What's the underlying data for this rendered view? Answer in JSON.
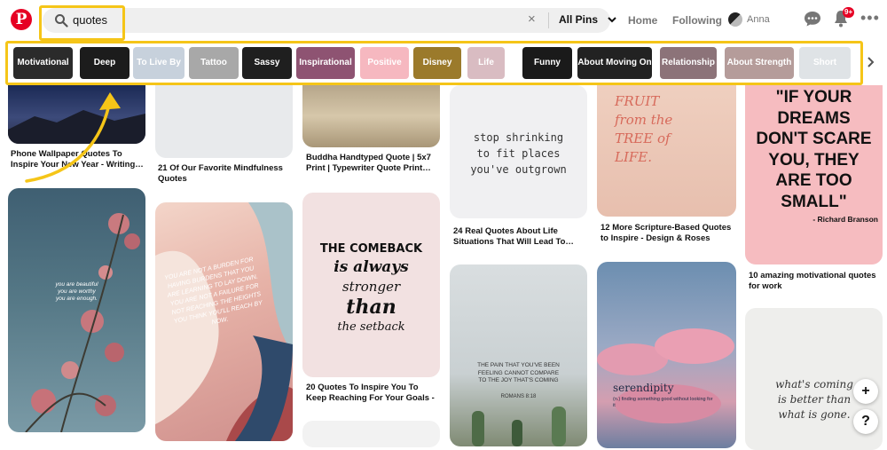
{
  "header": {
    "logo": "P",
    "search_value": "quotes",
    "clear_symbol": "×",
    "search_scope": "All Pins",
    "nav": {
      "home": "Home",
      "following": "Following",
      "user": "Anna"
    },
    "notification_count": "9+",
    "more_symbol": "•••"
  },
  "filters": [
    {
      "label": "Motivational",
      "color": "#2b2b2b"
    },
    {
      "label": "Deep",
      "color": "#1c1c1c"
    },
    {
      "label": "To Live By",
      "color": "#c7d1dc"
    },
    {
      "label": "Tattoo",
      "color": "#a8a8a8"
    },
    {
      "label": "Sassy",
      "color": "#1f1f1f"
    },
    {
      "label": "Inspirational",
      "color": "#8e5372"
    },
    {
      "label": "Positive",
      "color": "#f6b8c0"
    },
    {
      "label": "Disney",
      "color": "#9b7a2b"
    },
    {
      "label": "Life",
      "color": "#d9bcc2"
    },
    {
      "label": "Funny",
      "color": "#1a1a1a"
    },
    {
      "label": "About Moving On",
      "color": "#222222"
    },
    {
      "label": "Relationship",
      "color": "#8c7379"
    },
    {
      "label": "About Strength",
      "color": "#b59c9a"
    },
    {
      "label": "Short",
      "color": "#dfe3e6"
    }
  ],
  "pins": {
    "p1": {
      "caption": "Phone Wallpaper Quotes To Inspire Your New Year - Writing…"
    },
    "p2": {
      "caption": "21 Of Our Favorite Mindfulness Quotes"
    },
    "p3": {
      "caption": "Buddha Handtyped Quote | 5x7 Print | Typewriter Quote Print…"
    },
    "p4": {
      "text": "stop shrinking\nto fit places\nyou've outgrown",
      "caption": "24 Real Quotes About Life Situations That Will Lead To…"
    },
    "p5": {
      "text": "FRUIT\nfrom the\nTREE of\nLIFE.",
      "caption": "12 More Scripture-Based Quotes to Inspire - Design & Roses"
    },
    "p6": {
      "text": "\"IF YOUR DREAMS DON'T SCARE YOU, THEY ARE TOO SMALL\"",
      "author": "- Richard Branson",
      "caption": "10 amazing motivational quotes for work"
    },
    "p7": {
      "text": "you are beautiful\nyou are worthy\nyou are enough."
    },
    "p8": {
      "text": "YOU ARE NOT A BURDEN FOR HAVING BURDENS THAT YOU ARE LEARNING TO LAY DOWN. YOU ARE NOT A FAILURE FOR NOT REACHING THE HEIGHTS YOU THINK YOU'LL REACH BY NOW."
    },
    "p9": {
      "text_1": "THE COMEBACK",
      "text_2": "is always",
      "text_3": "stronger",
      "text_4": "than",
      "text_5": "the setback",
      "caption": "20 Quotes To Inspire You To Keep Reaching For Your Goals -"
    },
    "p10": {
      "text": "THE PAIN THAT YOU'VE BEEN FEELING CANNOT COMPARE TO THE JOY THAT'S COMING",
      "ref": "ROMANS 8:18"
    },
    "p11": {
      "title": "serendipity",
      "sub": "(n.) finding something good without looking for it"
    },
    "p12": {
      "text": "what's coming is better than what is gone."
    }
  },
  "fab": {
    "plus": "+",
    "help": "?"
  },
  "colors": {
    "highlight": "#f5c518",
    "brand": "#e60023"
  }
}
